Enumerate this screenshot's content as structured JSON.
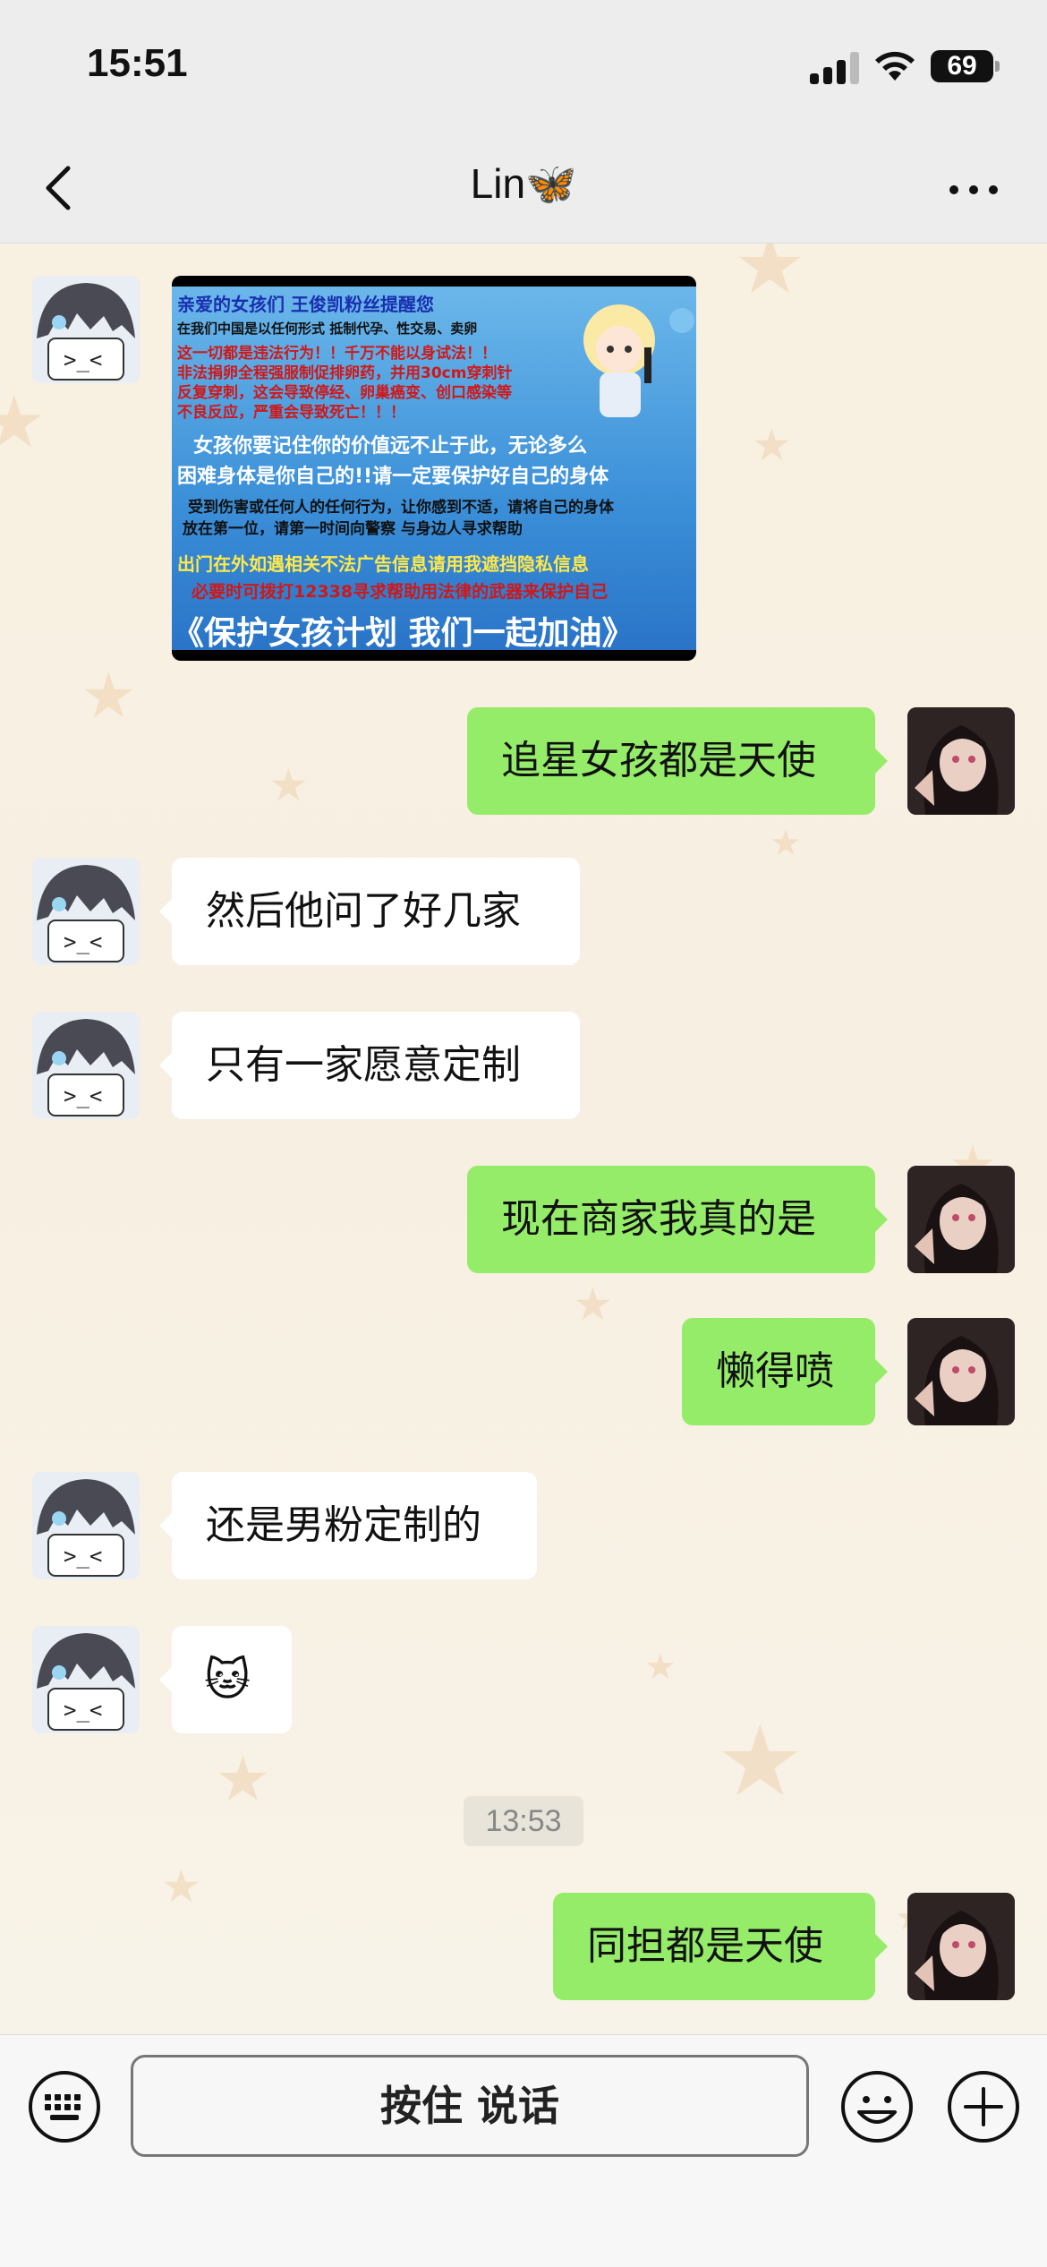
{
  "status_bar": {
    "time": "15:51",
    "battery": "69"
  },
  "nav": {
    "title": "Lin🦋"
  },
  "image_message": {
    "lines": [
      "亲爱的女孩们  王俊凯粉丝提醒您",
      "在我们中国是以任何形式 抵制代孕、性交易、卖卵",
      "这一切都是违法行为！！千万不能以身试法！！",
      "非法捐卵全程强服制促排卵药，并用30cm穿刺针",
      "反复穿刺，这会导致停经、卵巢癌变、创口感染等",
      "不良反应，严重会导致死亡！！！",
      "女孩你要记住你的价值远不止于此，无论多么",
      "困难身体是你自己的!!请一定要保护好自己的身体",
      "受到伤害或任何人的任何行为，让你感到不适，请将自己的身体",
      "放在第一位，请第一时间向警察 与身边人寻求帮助",
      "出门在外如遇相关不法广告信息请用我遮挡隐私信息",
      "必要时可拨打12338寻求帮助用法律的武器来保护自己",
      "《保护女孩计划 我们一起加油》"
    ]
  },
  "messages": [
    {
      "side": "right",
      "text": "追星女孩都是天使"
    },
    {
      "side": "left",
      "text": "然后他问了好几家"
    },
    {
      "side": "left",
      "text": "只有一家愿意定制"
    },
    {
      "side": "right",
      "text": "现在商家我真的是"
    },
    {
      "side": "right",
      "text": "懒得喷"
    },
    {
      "side": "left",
      "text": "还是男粉定制的"
    },
    {
      "side": "left",
      "text": "🐱"
    },
    {
      "side": "right",
      "text": "同担都是天使"
    }
  ],
  "timestamp": "13:53",
  "input_bar": {
    "hold_to_talk_label": "按住 说话"
  },
  "colors": {
    "bubble_green": "#95ec69",
    "bubble_white": "#ffffff",
    "bar_gray": "#ededed",
    "chat_bg": "#f6f1e3"
  },
  "icons": {
    "back": "back-icon",
    "more": "more-icon",
    "keyboard": "keyboard-icon",
    "emoji": "emoji-icon",
    "plus": "plus-icon"
  }
}
